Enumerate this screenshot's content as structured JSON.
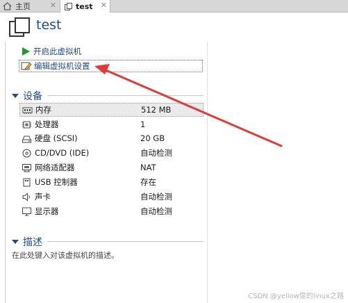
{
  "tabs": [
    {
      "label": "主页",
      "icon": "home-icon",
      "close": "✕"
    },
    {
      "label": "test",
      "icon": "vm-icon",
      "close": "✕"
    }
  ],
  "header": {
    "title": "test",
    "icon": "vm-icon"
  },
  "actions": {
    "start_label": "开启此虚拟机",
    "edit_label": "编辑虚拟机设置"
  },
  "devices": {
    "section_label": "设备",
    "items": [
      {
        "name": "内存",
        "value": "512 MB",
        "icon": "memory-icon"
      },
      {
        "name": "处理器",
        "value": "1",
        "icon": "cpu-icon"
      },
      {
        "name": "硬盘 (SCSI)",
        "value": "20 GB",
        "icon": "hard-disk-icon"
      },
      {
        "name": "CD/DVD (IDE)",
        "value": "自动检测",
        "icon": "cd-dvd-icon"
      },
      {
        "name": "网络适配器",
        "value": "NAT",
        "icon": "network-adapter-icon"
      },
      {
        "name": "USB 控制器",
        "value": "存在",
        "icon": "usb-icon"
      },
      {
        "name": "声卡",
        "value": "自动检测",
        "icon": "speaker-icon"
      },
      {
        "name": "显示器",
        "value": "自动检测",
        "icon": "monitor-icon"
      }
    ]
  },
  "description": {
    "section_label": "描述",
    "placeholder": "在此处键入对该虚拟机的描述。"
  },
  "annotation": {
    "arrow_color": "#e53935"
  },
  "watermark": "CSDN @yellow俊的linux之路",
  "colors": {
    "accent": "#1f4b8f",
    "play": "#1e9a28"
  }
}
